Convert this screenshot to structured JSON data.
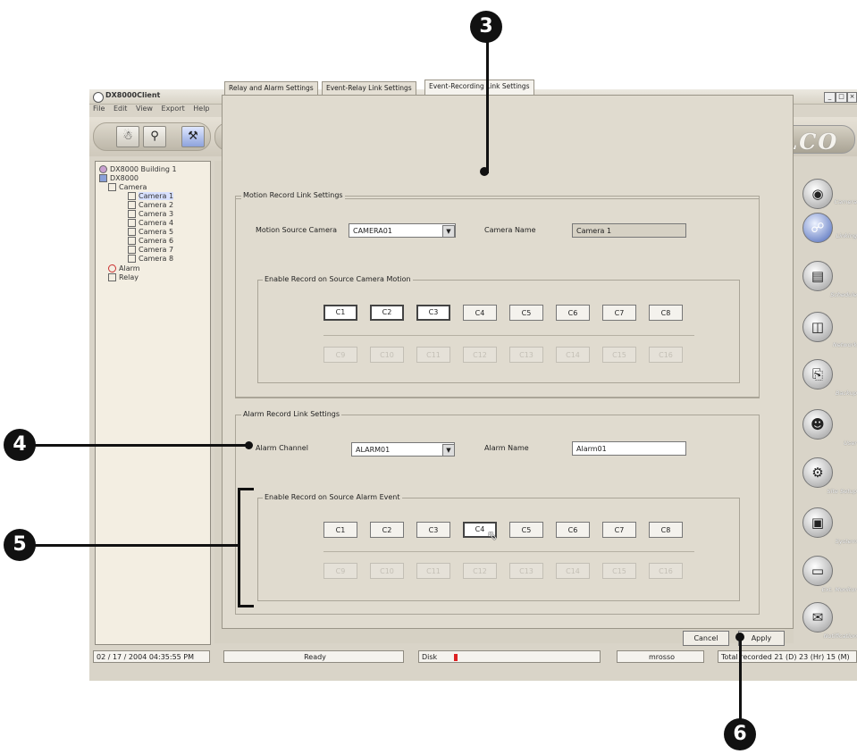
{
  "window": {
    "title": "DX8000Client",
    "controls": [
      "_",
      "□",
      "×"
    ]
  },
  "menu": [
    "File",
    "Edit",
    "View",
    "Export",
    "Help"
  ],
  "toolbar": {
    "logo": "PELCO"
  },
  "tree": {
    "items": [
      {
        "label": "DX8000 Building 1"
      },
      {
        "label": "DX8000"
      },
      {
        "label": "Camera"
      },
      {
        "label": "Camera 1"
      },
      {
        "label": "Camera 2"
      },
      {
        "label": "Camera 3"
      },
      {
        "label": "Camera 4"
      },
      {
        "label": "Camera 5"
      },
      {
        "label": "Camera 6"
      },
      {
        "label": "Camera 7"
      },
      {
        "label": "Camera 8"
      },
      {
        "label": "Alarm"
      },
      {
        "label": "Relay"
      }
    ]
  },
  "tabs": [
    {
      "label": "Relay and Alarm Settings"
    },
    {
      "label": "Event-Relay Link Settings"
    },
    {
      "label": "Event-Recording Link Settings"
    }
  ],
  "motion": {
    "group_label": "Motion Record Link Settings",
    "source_label": "Motion Source Camera",
    "source_value": "CAMERA01",
    "name_label": "Camera Name",
    "name_value": "Camera 1",
    "enable_label": "Enable Record on Source Camera Motion",
    "row1": [
      "C1",
      "C2",
      "C3",
      "C4",
      "C5",
      "C6",
      "C7",
      "C8"
    ],
    "row2": [
      "C9",
      "C10",
      "C11",
      "C12",
      "C13",
      "C14",
      "C15",
      "C16"
    ]
  },
  "alarm": {
    "group_label": "Alarm Record Link Settings",
    "channel_label": "Alarm Channel",
    "channel_value": "ALARM01",
    "name_label": "Alarm Name",
    "name_value": "Alarm01",
    "enable_label": "Enable Record on Source Alarm Event",
    "row1": [
      "C1",
      "C2",
      "C3",
      "C4",
      "C5",
      "C6",
      "C7",
      "C8"
    ],
    "row2": [
      "C9",
      "C10",
      "C11",
      "C12",
      "C13",
      "C14",
      "C15",
      "C16"
    ]
  },
  "actions": {
    "cancel": "Cancel",
    "apply": "Apply"
  },
  "sidenav": [
    "Camera",
    "Linking",
    "Schedule",
    "Network",
    "Backup",
    "User",
    "Site Setup",
    "System",
    "Ext. Monitor",
    "Notification"
  ],
  "status": {
    "datetime": "02 / 17 / 2004  04:35:55 PM",
    "state": "Ready",
    "disk": "Disk",
    "user": "mrosso",
    "recorded": "Total recorded 21 (D) 23 (Hr) 15 (M)"
  },
  "callouts": [
    "3",
    "4",
    "5",
    "6"
  ]
}
